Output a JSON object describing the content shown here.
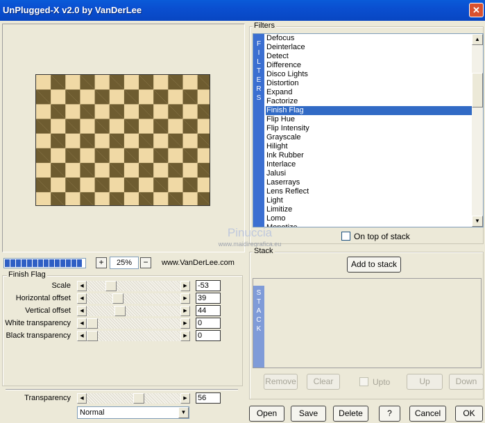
{
  "window": {
    "title": "UnPlugged-X v2.0 by VanDerLee",
    "close_glyph": "✕"
  },
  "filters": {
    "group_label": "Filters",
    "sidebar_letters": [
      "F",
      "I",
      "L",
      "T",
      "E",
      "R",
      "S"
    ],
    "items": [
      "Defocus",
      "Deinterlace",
      "Detect",
      "Difference",
      "Disco Lights",
      "Distortion",
      "Expand",
      "Factorize",
      "Finish Flag",
      "Flip Hue",
      "Flip Intensity",
      "Grayscale",
      "Hilight",
      "Ink Rubber",
      "Interlace",
      "Jalusi",
      "Laserrays",
      "Lens Reflect",
      "Light",
      "Limitize",
      "Lomo",
      "Monotize"
    ],
    "selected": "Finish Flag",
    "on_top_label": "On top of stack",
    "on_top_checked": false
  },
  "watermark": {
    "name": "Pinuccia",
    "url": "www.maidiregrafica.eu"
  },
  "zoom": {
    "plus": "+",
    "minus": "−",
    "value": "25%",
    "website": "www.VanDerLee.com",
    "progress": 1.0
  },
  "finish_flag": {
    "group_label": "Finish Flag",
    "params": [
      {
        "label": "Scale",
        "value": "-53",
        "position": 0.23
      },
      {
        "label": "Horizontal offset",
        "value": "39",
        "position": 0.31
      },
      {
        "label": "Vertical offset",
        "value": "44",
        "position": 0.34
      },
      {
        "label": "White transparency",
        "value": "0",
        "position": 0.0
      },
      {
        "label": "Black transparency",
        "value": "0",
        "position": 0.0
      }
    ]
  },
  "transparency": {
    "label": "Transparency",
    "value": "56",
    "position": 0.56,
    "blend_mode": "Normal"
  },
  "stack": {
    "group_label": "Stack",
    "add_label": "Add to stack",
    "sidebar_letters": [
      "S",
      "T",
      "A",
      "C",
      "K"
    ],
    "remove_label": "Remove",
    "clear_label": "Clear",
    "upto_label": "Upto",
    "up_label": "Up",
    "down_label": "Down"
  },
  "footer": {
    "open": "Open",
    "save": "Save",
    "delete": "Delete",
    "help": "?",
    "cancel": "Cancel",
    "ok": "OK"
  },
  "colors": {
    "title_bar": "#0a5bd8",
    "selection": "#316ac5",
    "checker_dark": "#6e5c30",
    "checker_light": "#f0d9a5"
  }
}
